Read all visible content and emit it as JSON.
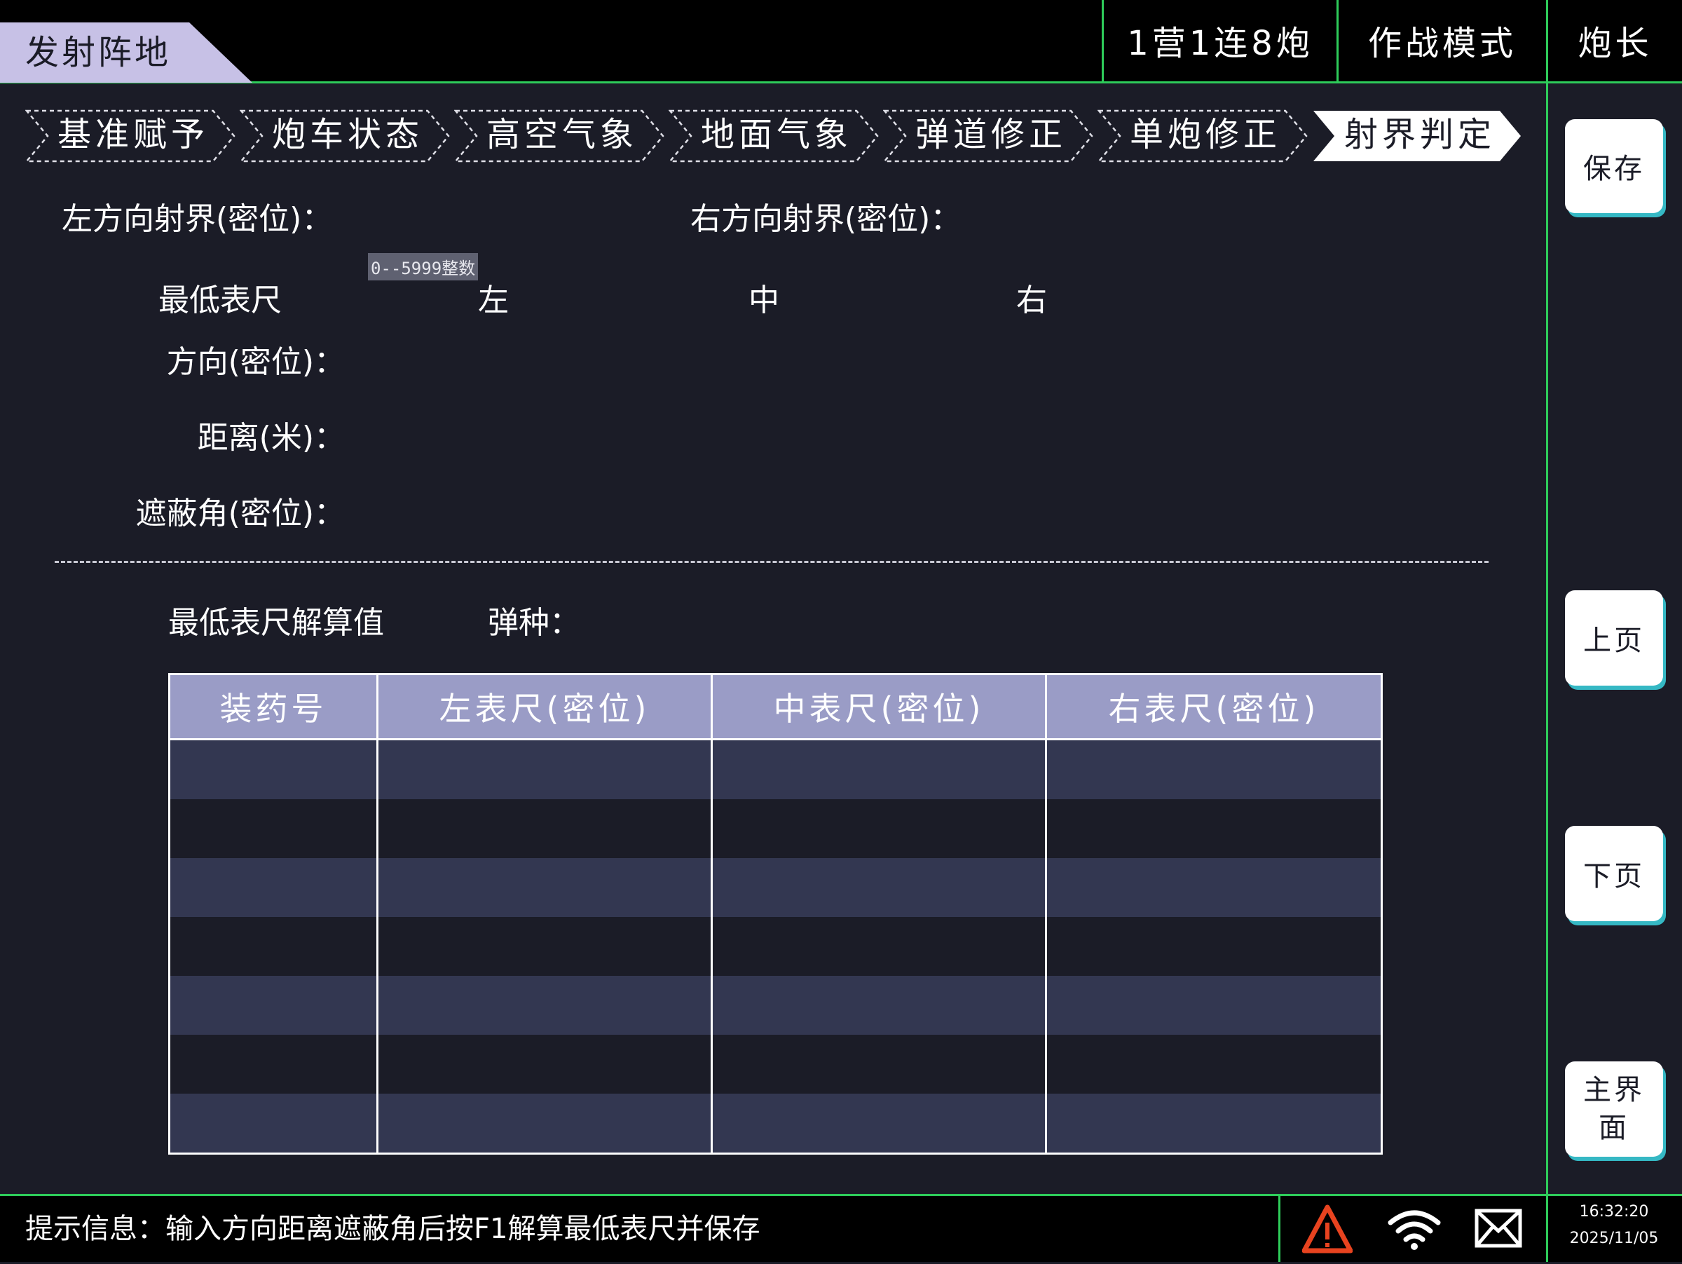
{
  "header": {
    "title": "发射阵地",
    "unit": "1营1连8炮",
    "mode": "作战模式",
    "role": "炮长"
  },
  "steps": [
    {
      "label": "基准赋予",
      "active": false
    },
    {
      "label": "炮车状态",
      "active": false
    },
    {
      "label": "高空气象",
      "active": false
    },
    {
      "label": "地面气象",
      "active": false
    },
    {
      "label": "弹道修正",
      "active": false
    },
    {
      "label": "单炮修正",
      "active": false
    },
    {
      "label": "射界判定",
      "active": true
    }
  ],
  "form": {
    "left_limit_label": "左方向射界(密位)：",
    "right_limit_label": "右方向射界(密位)：",
    "range_hint": "0--5999整数",
    "min_scale_label": "最低表尺",
    "col_left": "左",
    "col_mid": "中",
    "col_right": "右",
    "direction_label": "方向(密位)：",
    "distance_label": "距离(米)：",
    "mask_angle_label": "遮蔽角(密位)："
  },
  "results": {
    "title": "最低表尺解算值",
    "ammo_label": "弹种：",
    "columns": [
      "装药号",
      "左表尺(密位)",
      "中表尺(密位)",
      "右表尺(密位)"
    ],
    "rows": [
      [
        "",
        "",
        "",
        ""
      ],
      [
        "",
        "",
        "",
        ""
      ],
      [
        "",
        "",
        "",
        ""
      ],
      [
        "",
        "",
        "",
        ""
      ],
      [
        "",
        "",
        "",
        ""
      ],
      [
        "",
        "",
        "",
        ""
      ],
      [
        "",
        "",
        "",
        ""
      ]
    ]
  },
  "sidebar": {
    "save": "保存",
    "prev_page": "上页",
    "next_page": "下页",
    "main_menu": "主界面"
  },
  "status": {
    "message": "提示信息：输入方向距离遮蔽角后按F1解算最低表尺并保存",
    "time": "16:32:20",
    "date": "2025/11/05",
    "icons": [
      "warning-icon",
      "wifi-icon",
      "mail-icon"
    ],
    "warning_color": "#e8431f"
  }
}
